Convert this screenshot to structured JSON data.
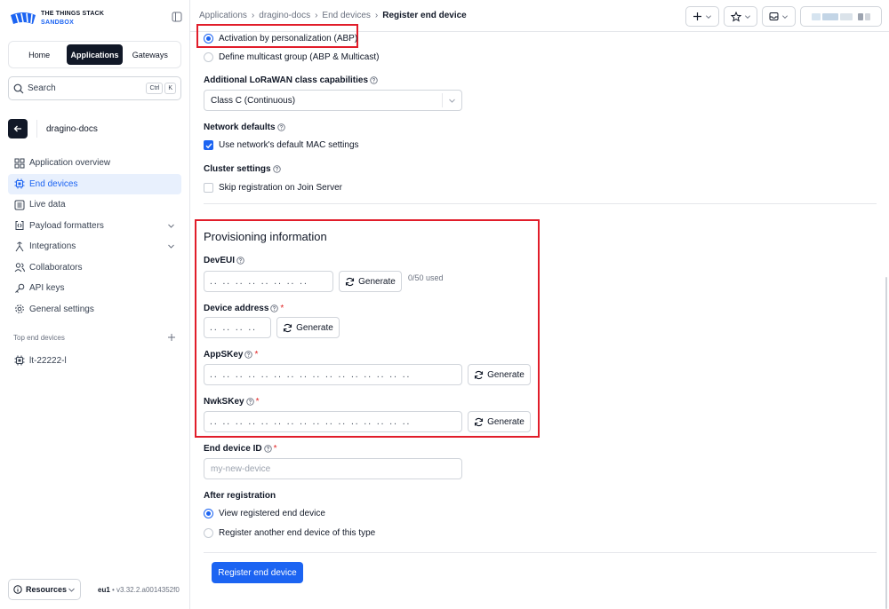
{
  "brand": {
    "line1": "THE THINGS STACK",
    "line2": "SANDBOX",
    "colors": {
      "accent": "#1c64f2",
      "dark": "#111827",
      "error": "#e11d2a"
    }
  },
  "sidebar": {
    "tabs": [
      {
        "label": "Home",
        "active": false
      },
      {
        "label": "Applications",
        "active": true
      },
      {
        "label": "Gateways",
        "active": false
      }
    ],
    "search": {
      "placeholder": "Search",
      "shortcut_keys": [
        "Ctrl",
        "K"
      ]
    },
    "application_name": "dragino-docs",
    "nav_items": [
      {
        "label": "Application overview",
        "icon": "grid-icon",
        "active": false
      },
      {
        "label": "End devices",
        "icon": "chip-icon",
        "active": true
      },
      {
        "label": "Live data",
        "icon": "list-icon",
        "active": false
      },
      {
        "label": "Payload formatters",
        "icon": "code-icon",
        "active": false,
        "expandable": true
      },
      {
        "label": "Integrations",
        "icon": "integrations-icon",
        "active": false,
        "expandable": true
      },
      {
        "label": "Collaborators",
        "icon": "users-icon",
        "active": false
      },
      {
        "label": "API keys",
        "icon": "key-icon",
        "active": false
      },
      {
        "label": "General settings",
        "icon": "gear-icon",
        "active": false
      }
    ],
    "top_end_devices_heading": "Top end devices",
    "top_end_devices": [
      {
        "label": "lt-22222-l",
        "icon": "chip-icon"
      }
    ],
    "resources_label": "Resources",
    "cluster": "eu1",
    "version": "v3.32.2.a0014352f0"
  },
  "header": {
    "breadcrumbs": [
      "Applications",
      "dragino-docs",
      "End devices"
    ],
    "current": "Register end device"
  },
  "form": {
    "activation": {
      "options": [
        {
          "label": "Activation by personalization (ABP)",
          "selected": true
        },
        {
          "label": "Define multicast group (ABP & Multicast)",
          "selected": false
        }
      ]
    },
    "class_capabilities": {
      "label": "Additional LoRaWAN class capabilities",
      "value": "Class C (Continuous)"
    },
    "network_defaults": {
      "label": "Network defaults",
      "checkbox_label": "Use network's default MAC settings",
      "checked": true
    },
    "cluster_settings": {
      "label": "Cluster settings",
      "checkbox_label": "Skip registration on Join Server",
      "checked": false
    },
    "provisioning": {
      "title": "Provisioning information",
      "generate_label": "Generate",
      "dev_eui": {
        "label": "DevEUI",
        "value": ".. .. .. .. .. .. .. ..",
        "usage": "0/50 used"
      },
      "device_address": {
        "label": "Device address",
        "value": ".. .. .. .."
      },
      "app_s_key": {
        "label": "AppSKey",
        "value": ".. .. .. .. .. .. .. .. .. .. .. .. .. .. .. .."
      },
      "nwk_s_key": {
        "label": "NwkSKey",
        "value": ".. .. .. .. .. .. .. .. .. .. .. .. .. .. .. .."
      }
    },
    "end_device_id": {
      "label": "End device ID",
      "placeholder": "my-new-device"
    },
    "after_registration": {
      "label": "After registration",
      "options": [
        {
          "label": "View registered end device",
          "selected": true
        },
        {
          "label": "Register another end device of this type",
          "selected": false
        }
      ]
    },
    "submit_label": "Register end device"
  }
}
